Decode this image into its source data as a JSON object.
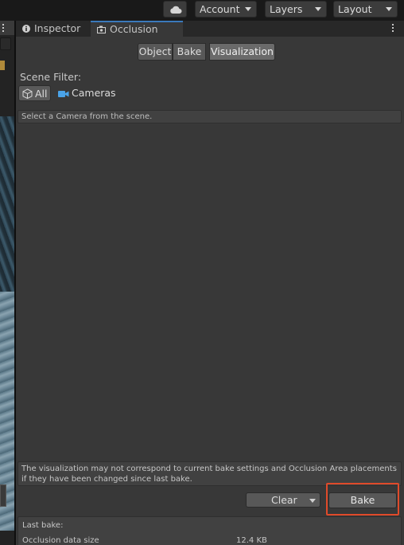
{
  "toolbar": {
    "cloud_icon": "cloud-icon",
    "account_label": "Account",
    "layers_label": "Layers",
    "layout_label": "Layout"
  },
  "tabs": {
    "inspector_label": "Inspector",
    "occlusion_label": "Occlusion",
    "accent_color": "#3a79bb"
  },
  "occlusion": {
    "mode_buttons": {
      "object": "Object",
      "bake": "Bake",
      "visualization": "Visualization"
    },
    "active_mode": "Visualization",
    "scene_filter_label": "Scene Filter:",
    "filter_all_label": "All",
    "filter_cameras_label": "Cameras",
    "camera_notice": "Select a Camera from the scene.",
    "warning_text": "The visualization may not correspond to current bake settings and Occlusion Area placements if they have been changed since last bake.",
    "clear_label": "Clear",
    "bake_label": "Bake",
    "highlight_color": "#e04a2a",
    "last_bake": {
      "title": "Last bake:",
      "rows": [
        {
          "key": "Occlusion data size",
          "value": "12.4 KB"
        }
      ]
    }
  }
}
